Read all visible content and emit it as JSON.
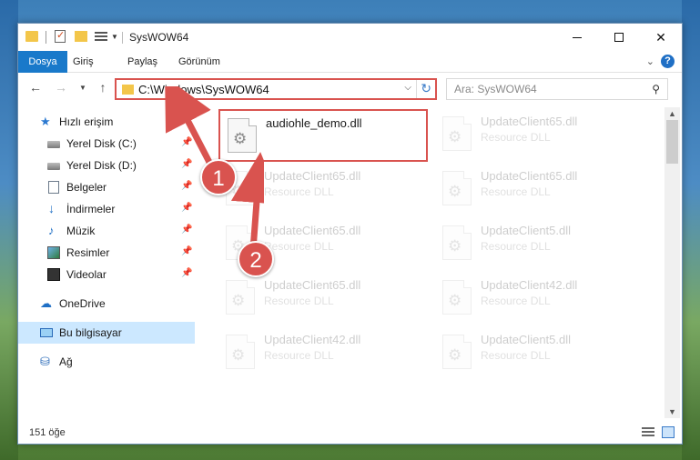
{
  "window": {
    "title": "SysWOW64",
    "controls": {
      "close": "✕"
    }
  },
  "ribbon": {
    "tabs": [
      "Dosya",
      "Giriş",
      "Paylaş",
      "Görünüm"
    ],
    "help": "?"
  },
  "address": {
    "path": "C:\\Windows\\SysWOW64",
    "search_placeholder": "Ara: SysWOW64"
  },
  "sidebar": {
    "items": [
      {
        "label": "Hızlı erişim",
        "icon": "star-icon"
      },
      {
        "label": "Yerel Disk (C:)",
        "icon": "disk-icon",
        "pinned": true
      },
      {
        "label": "Yerel Disk (D:)",
        "icon": "disk-icon",
        "pinned": true
      },
      {
        "label": "Belgeler",
        "icon": "document-icon",
        "pinned": true
      },
      {
        "label": "İndirmeler",
        "icon": "download-icon",
        "pinned": true
      },
      {
        "label": "Müzik",
        "icon": "music-icon",
        "pinned": true
      },
      {
        "label": "Resimler",
        "icon": "picture-icon",
        "pinned": true
      },
      {
        "label": "Videolar",
        "icon": "video-icon",
        "pinned": true
      },
      {
        "label": "OneDrive",
        "icon": "cloud-icon"
      },
      {
        "label": "Bu bilgisayar",
        "icon": "computer-icon",
        "selected": true
      },
      {
        "label": "Ağ",
        "icon": "network-icon"
      }
    ]
  },
  "files": [
    {
      "name": "audiohle_demo.dll",
      "type": ""
    },
    {
      "name": "UpdateClient65.dll",
      "type": "Resource DLL"
    },
    {
      "name": "UpdateClient65.dll",
      "type": "Resource DLL"
    },
    {
      "name": "UpdateClient65.dll",
      "type": "Resource DLL"
    },
    {
      "name": "UpdateClient65.dll",
      "type": "Resource DLL"
    },
    {
      "name": "UpdateClient5.dll",
      "type": "Resource DLL"
    },
    {
      "name": "UpdateClient65.dll",
      "type": "Resource DLL"
    },
    {
      "name": "UpdateClient42.dll",
      "type": "Resource DLL"
    },
    {
      "name": "UpdateClient42.dll",
      "type": "Resource DLL"
    },
    {
      "name": "UpdateClient5.dll",
      "type": "Resource DLL"
    }
  ],
  "status": {
    "count": "151 öğe"
  },
  "annotations": {
    "step1": "1",
    "step2": "2",
    "color": "#d9534f"
  }
}
